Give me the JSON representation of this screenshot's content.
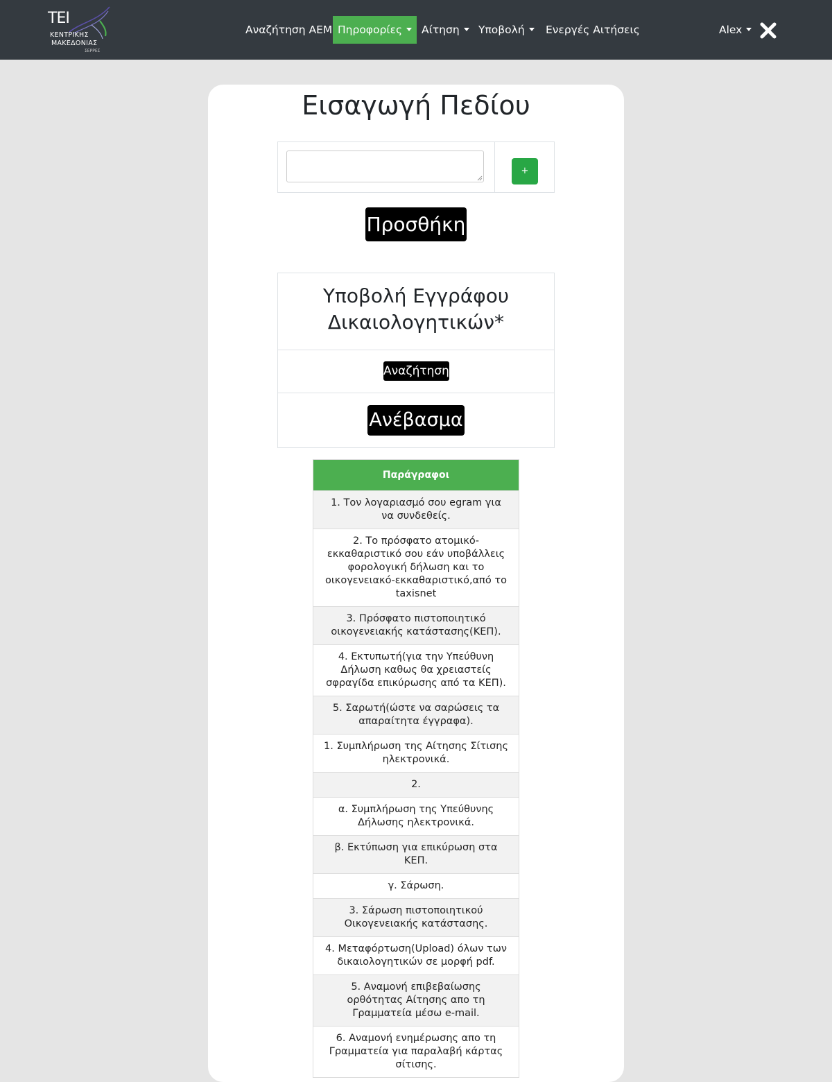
{
  "logo": {
    "mark": "TEI",
    "line1": "ΚΕΝΤΡΙΚΗΣ",
    "line2": "ΜΑΚΕΔΟΝΙΑΣ",
    "line3": "ΣΕΡΡΕΣ"
  },
  "nav": {
    "search_aem": "Αναζήτηση ΑΕΜ",
    "info": "Πηροφορίες",
    "application": "Αίτηση",
    "submission": "Υποβολή",
    "active_applications": "Ενεργές Αιτήσεις",
    "user": "Alex",
    "close_icon": "close-icon"
  },
  "colors": {
    "navbar": "#343a40",
    "accent_green": "#4caf50",
    "plus_green": "#28a745",
    "page_bg": "#e5e5e5"
  },
  "main": {
    "title": "Εισαγωγή Πεδίου",
    "field_value": "",
    "plus_label": "+",
    "add_button": "Προσθήκη",
    "upload_title_line1": "Υποβολή Εγγράφου",
    "upload_title_line2": "Δικαιολογητικών*",
    "search_button": "Αναζήτηση",
    "upload_button": "Ανέβασμα"
  },
  "table": {
    "header": "Παράγραφοι",
    "rows": [
      "1. Τον λογαριασμό σου egram για να συνδεθείς.",
      "2. Το πρόσφατο ατομικό-εκκαθαριστικό σου εάν υποβάλλεις φορολογική δήλωση και το οικογενειακό-εκκαθαριστικό,από το taxisnet",
      "3. Πρόσφατο πιστοποιητικό οικογενειακής κατάστασης(ΚΕΠ).",
      "4. Εκτυπωτή(για την Υπεύθυνη Δήλωση καθως θα χρειαστείς σφραγίδα επικύρωσης από τα ΚΕΠ).",
      "5. Σαρωτή(ώστε να σαρώσεις τα απαραίτητα έγγραφα).",
      "1. Συμπλήρωση της Αίτησης Σίτισης ηλεκτρονικά.",
      "2.",
      "α. Συμπλήρωση της Υπεύθυνης Δήλωσης ηλεκτρονικά.",
      "β. Εκτύπωση για επικύρωση στα ΚΕΠ.",
      "γ. Σάρωση.",
      "3. Σάρωση πιστοποιητικού Οικογενειακής κατάστασης.",
      "4. Μεταφόρτωση(Upload) όλων των δικαιολογητικών σε μορφή pdf.",
      "5. Αναμονή επιβεβαίωσης ορθότητας Αίτησης απο τη Γραμματεία μέσω e-mail.",
      "6. Αναμονή ενημέρωσης απο τη Γραμματεία για παραλαβή κάρτας σίτισης."
    ]
  }
}
